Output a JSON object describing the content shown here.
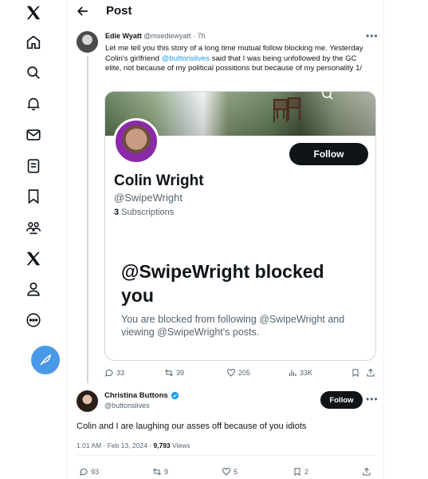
{
  "header": {
    "title": "Post"
  },
  "sidebar": {
    "items": [
      {
        "icon": "x-logo-icon"
      },
      {
        "icon": "home-icon"
      },
      {
        "icon": "search-icon"
      },
      {
        "icon": "notifications-icon"
      },
      {
        "icon": "messages-icon"
      },
      {
        "icon": "lists-icon"
      },
      {
        "icon": "bookmarks-icon"
      },
      {
        "icon": "communities-icon"
      },
      {
        "icon": "premium-x-icon"
      },
      {
        "icon": "profile-icon"
      },
      {
        "icon": "more-icon"
      }
    ],
    "compose_icon": "compose-feather-icon"
  },
  "tweet1": {
    "name": "Edie Wyatt",
    "handle": "@msediewyatt",
    "time": "· 7h",
    "body_part1": "Let me tell you this story of a long time mutual follow blocking me. Yesterday Colin's girlfriend ",
    "mention": "@buttonslives",
    "body_part2": " said that I was being unfollowed by the GC elite, not because of my political possitions but because of my personality 1/",
    "embed": {
      "follow_label": "Follow",
      "profile_name": "Colin Wright",
      "profile_handle": "@SwipeWright",
      "subs_count": "3",
      "subs_label": "Subscriptions",
      "blocked_title": "@SwipeWright blocked you",
      "blocked_text": "You are blocked from following @SwipeWright and viewing @SwipeWright's posts."
    },
    "stats": {
      "replies": "33",
      "reposts": "39",
      "likes": "205",
      "views": "33K"
    }
  },
  "tweet2": {
    "name": "Christina Buttons",
    "handle": "@buttonslives",
    "follow_label": "Follow",
    "body": "Colin and I are laughing our asses off because of you idiots",
    "time": "1:01 AM · Feb 13, 2024 · ",
    "views_count": "9,793",
    "views_label": " Views",
    "stats": {
      "replies": "93",
      "reposts": "9",
      "likes": "5",
      "bookmarks": "2"
    }
  },
  "colors": {
    "accent": "#1d9bf0",
    "compose": "#4a99e9",
    "text": "#0f1419",
    "muted": "#536471"
  }
}
